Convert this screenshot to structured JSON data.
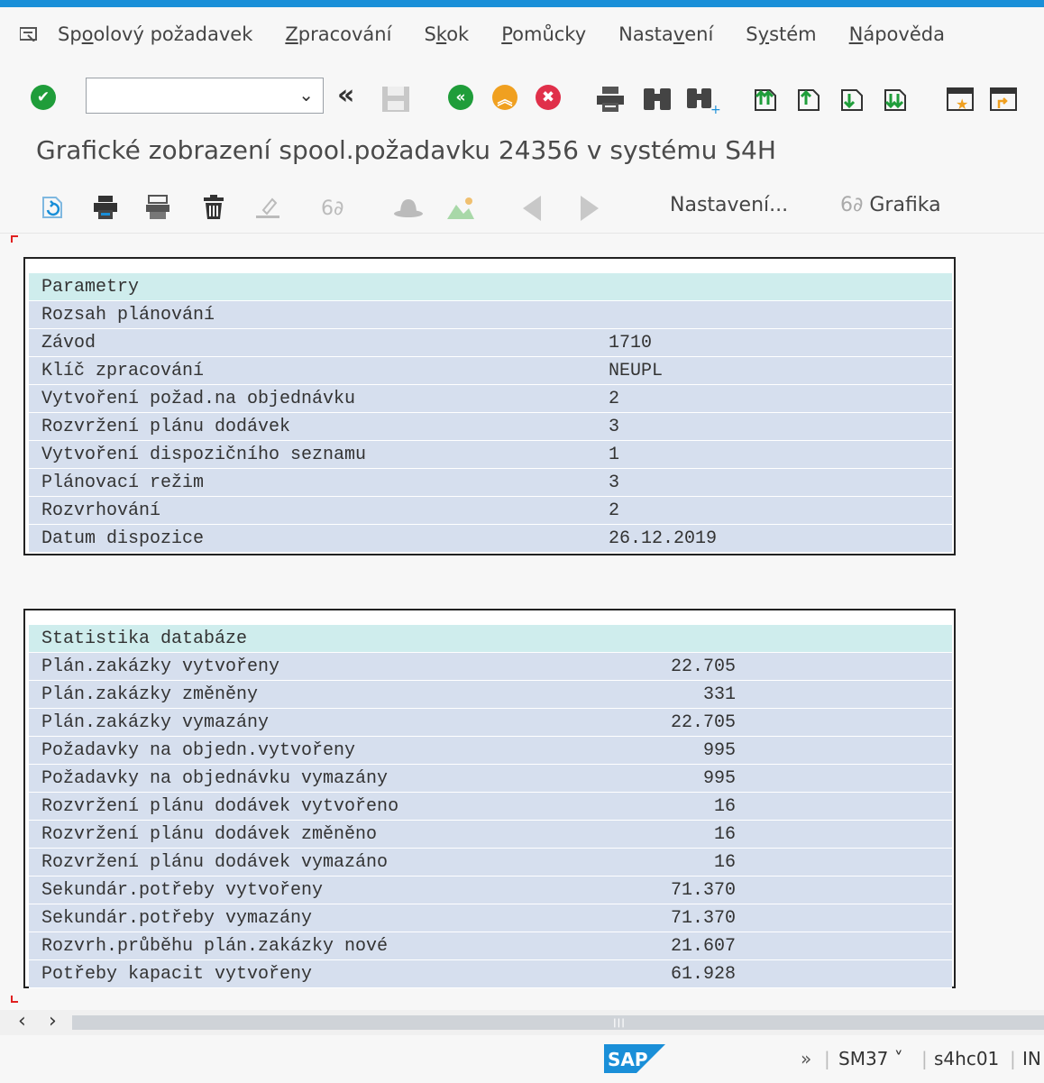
{
  "menu": {
    "items": [
      {
        "pre": "Sp",
        "ul": "o",
        "post": "olový požadavek"
      },
      {
        "pre": "",
        "ul": "Z",
        "post": "pracování"
      },
      {
        "pre": "S",
        "ul": "k",
        "post": "ok"
      },
      {
        "pre": "",
        "ul": "P",
        "post": "omůcky"
      },
      {
        "pre": "Nasta",
        "ul": "v",
        "post": "ení"
      },
      {
        "pre": "S",
        "ul": "y",
        "post": "stém"
      },
      {
        "pre": "",
        "ul": "N",
        "post": "ápověda"
      }
    ]
  },
  "toolbar": {
    "command_value": ""
  },
  "page": {
    "title": "Grafické zobrazení spool.požadavku 24356 v systému S4H"
  },
  "app_toolbar": {
    "settings_label": "Nastavení...",
    "graphics_label": "Grafika"
  },
  "parameters": {
    "header": "Parametry",
    "rows": [
      {
        "label": "Rozsah plánování",
        "value": ""
      },
      {
        "label": "Závod",
        "value": "1710"
      },
      {
        "label": "Klíč zpracování",
        "value": "NEUPL"
      },
      {
        "label": "Vytvoření požad.na objednávku",
        "value": "2"
      },
      {
        "label": "Rozvržení plánu dodávek",
        "value": "3"
      },
      {
        "label": "Vytvoření dispozičního seznamu",
        "value": "1"
      },
      {
        "label": "Plánovací režim",
        "value": "3"
      },
      {
        "label": "Rozvrhování",
        "value": "2"
      },
      {
        "label": "Datum dispozice",
        "value": "26.12.2019"
      }
    ]
  },
  "statistics": {
    "header": "Statistika databáze",
    "rows": [
      {
        "label": "Plán.zakázky vytvořeny",
        "value": "22.705"
      },
      {
        "label": "Plán.zakázky změněny",
        "value": "331"
      },
      {
        "label": "Plán.zakázky vymazány",
        "value": "22.705"
      },
      {
        "label": "Požadavky na objedn.vytvořeny",
        "value": "995"
      },
      {
        "label": "Požadavky na objednávku vymazány",
        "value": "995"
      },
      {
        "label": "Rozvržení plánu dodávek vytvořeno",
        "value": "16"
      },
      {
        "label": "Rozvržení plánu dodávek změněno",
        "value": "16"
      },
      {
        "label": "Rozvržení plánu dodávek vymazáno",
        "value": "16"
      },
      {
        "label": "Sekundár.potřeby vytvořeny",
        "value": "71.370"
      },
      {
        "label": "Sekundár.potřeby vymazány",
        "value": "71.370"
      },
      {
        "label": "Rozvrh.průběhu plán.zakázky nové",
        "value": "21.607"
      },
      {
        "label": "Potřeby kapacit vytvořeny",
        "value": "61.928"
      }
    ]
  },
  "status": {
    "more": "»",
    "transaction": "SM37",
    "server": "s4hc01",
    "mode": "IN",
    "logo": "SAP"
  },
  "colors": {
    "accent": "#1a8fd8",
    "row_bg": "#d6dfee",
    "header_bg": "#cfeded",
    "ok_green": "#1f9d3a",
    "warn_orange": "#f0a020",
    "cancel_red": "#e0304a"
  }
}
